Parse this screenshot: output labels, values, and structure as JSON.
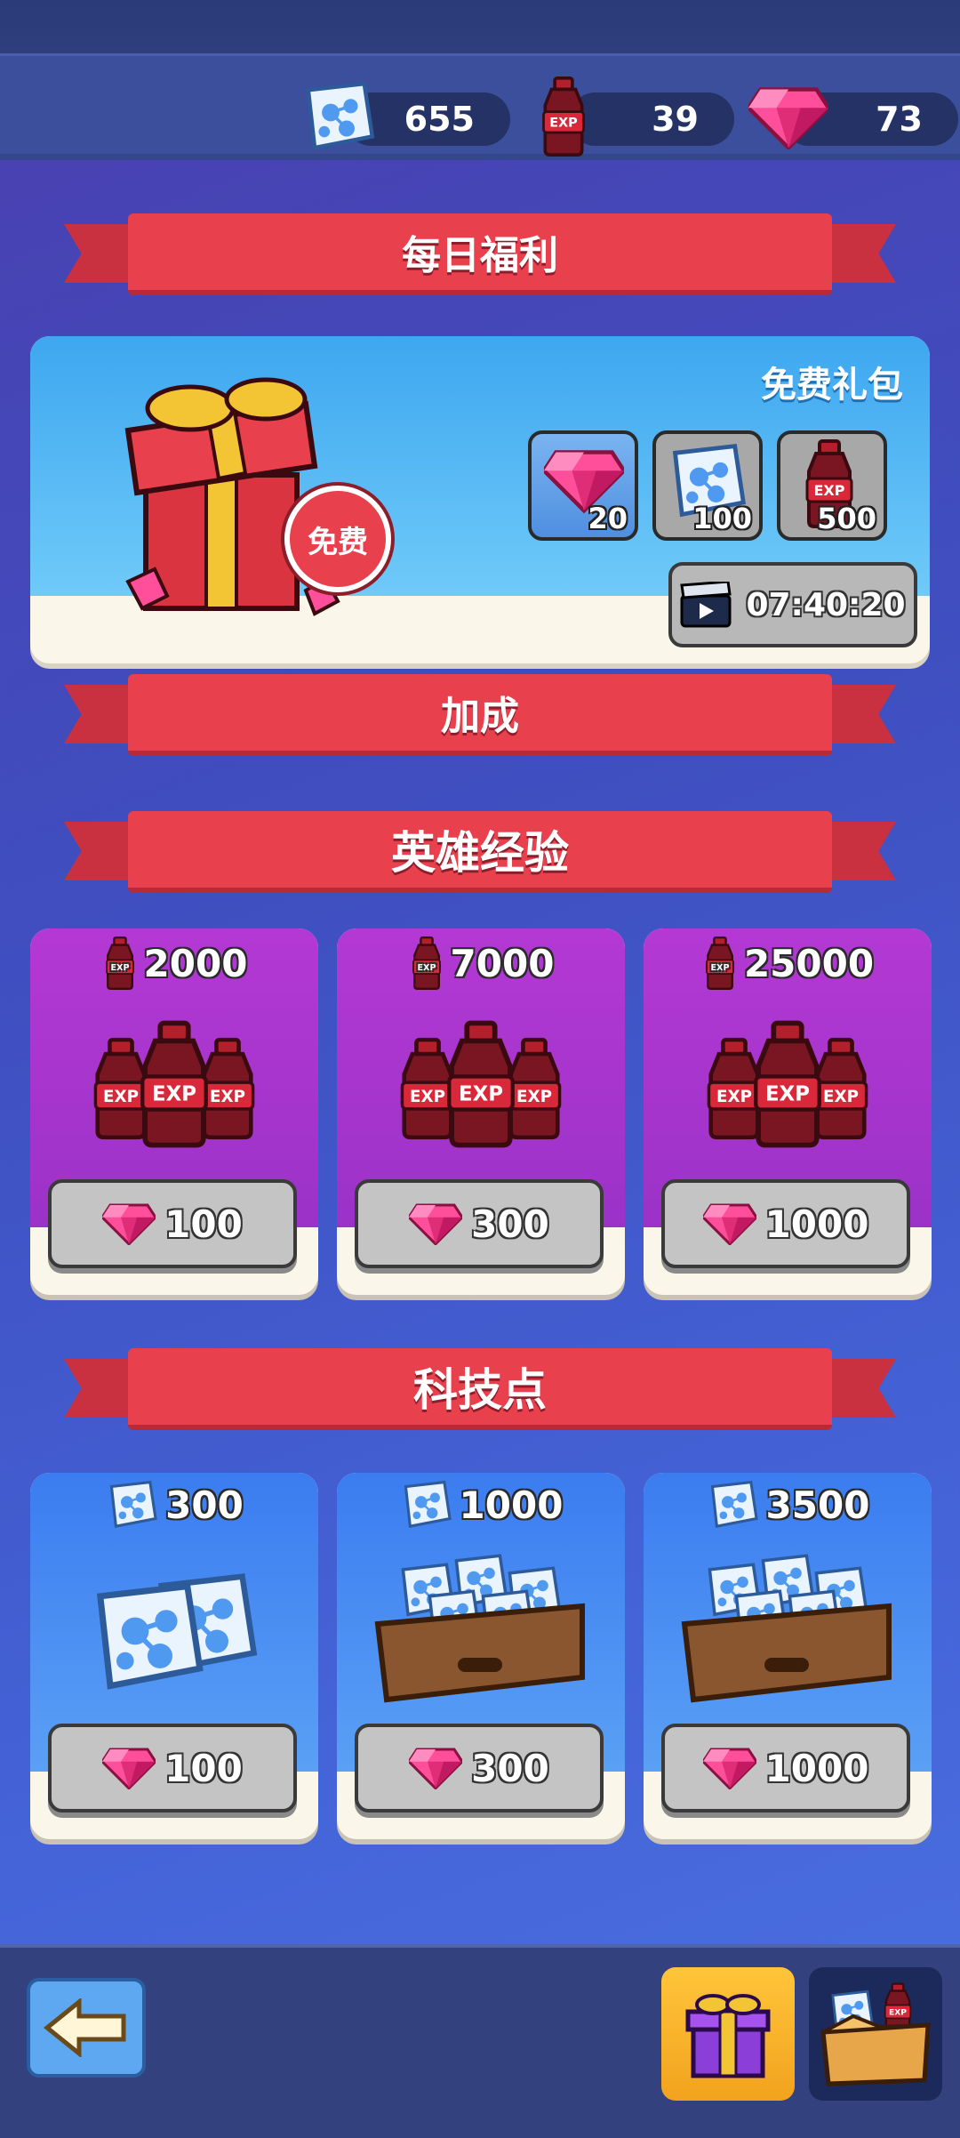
{
  "resources": {
    "tech_points": "655",
    "exp_bottles": "39",
    "gems": "73"
  },
  "sections": {
    "daily": "每日福利",
    "bonus": "加成",
    "hero_exp": "英雄经验",
    "tech": "科技点"
  },
  "daily_offer": {
    "title": "免费礼包",
    "free_badge": "免费",
    "rewards": [
      {
        "icon": "gem-icon",
        "amount": "20"
      },
      {
        "icon": "tech-point-icon",
        "amount": "100"
      },
      {
        "icon": "exp-bottle-icon",
        "amount": "500"
      }
    ],
    "timer": "07:40:20"
  },
  "exp_offers": [
    {
      "amount": "2000",
      "price": "100"
    },
    {
      "amount": "7000",
      "price": "300"
    },
    {
      "amount": "25000",
      "price": "1000"
    }
  ],
  "tech_offers": [
    {
      "amount": "300",
      "price": "100"
    },
    {
      "amount": "1000",
      "price": "300"
    },
    {
      "amount": "3500",
      "price": "1000"
    }
  ],
  "colors": {
    "ribbon": "#e8404d",
    "exp_card": "#b438d4",
    "tech_card": "#3b7cf0",
    "gem": "#e8357a"
  }
}
